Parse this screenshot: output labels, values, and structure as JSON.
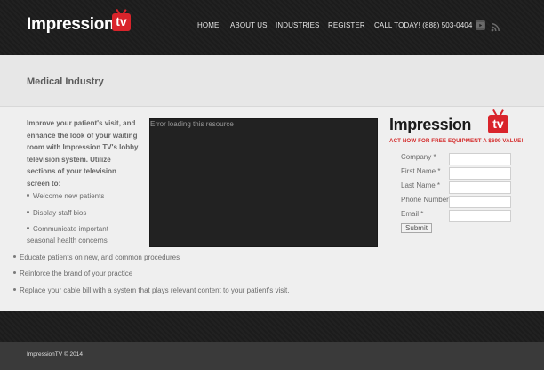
{
  "header": {
    "logo_text": "Impression",
    "logo_tv": "tv",
    "nav": [
      {
        "label": "HOME"
      },
      {
        "label": "ABOUT US"
      },
      {
        "label": "INDUSTRIES"
      },
      {
        "label": "REGISTER"
      },
      {
        "label": "CALL TODAY! (888) 503-0404"
      }
    ],
    "social_icons": [
      "youtube-icon",
      "rss-icon"
    ]
  },
  "page": {
    "title": "Medical Industry"
  },
  "main": {
    "intro": "Improve your patient's visit, and enhance the look of your waiting room with Impression TV's lobby television system. Utilize sections of your television screen to:",
    "bullets": [
      "Welcome new patients",
      "Display staff bios",
      "Communicate important seasonal health concerns",
      "Educate patients on new, and common procedures",
      "Reinforce the brand of your practice",
      "Replace your cable bill with a system that plays relevant content to your patient's visit."
    ],
    "video_error": "Error loading this resource"
  },
  "sidebar": {
    "logo_text": "Impression",
    "logo_tv": "tv",
    "promo": "ACT NOW FOR FREE EQUIPMENT A $699 VALUE!",
    "fields": [
      {
        "label": "Company *",
        "value": ""
      },
      {
        "label": "First Name *",
        "value": ""
      },
      {
        "label": "Last Name *",
        "value": ""
      },
      {
        "label": "Phone Number",
        "value": ""
      },
      {
        "label": "Email *",
        "value": ""
      }
    ],
    "submit_label": "Submit"
  },
  "footer": {
    "copyright": "ImpressionTV © 2014"
  },
  "colors": {
    "header_bg": "#1c1c1c",
    "brand_red": "#d9242b",
    "promo_red": "#d42a2a",
    "body_bg": "#efefef",
    "footer_bottom": "#3a3a3a"
  }
}
